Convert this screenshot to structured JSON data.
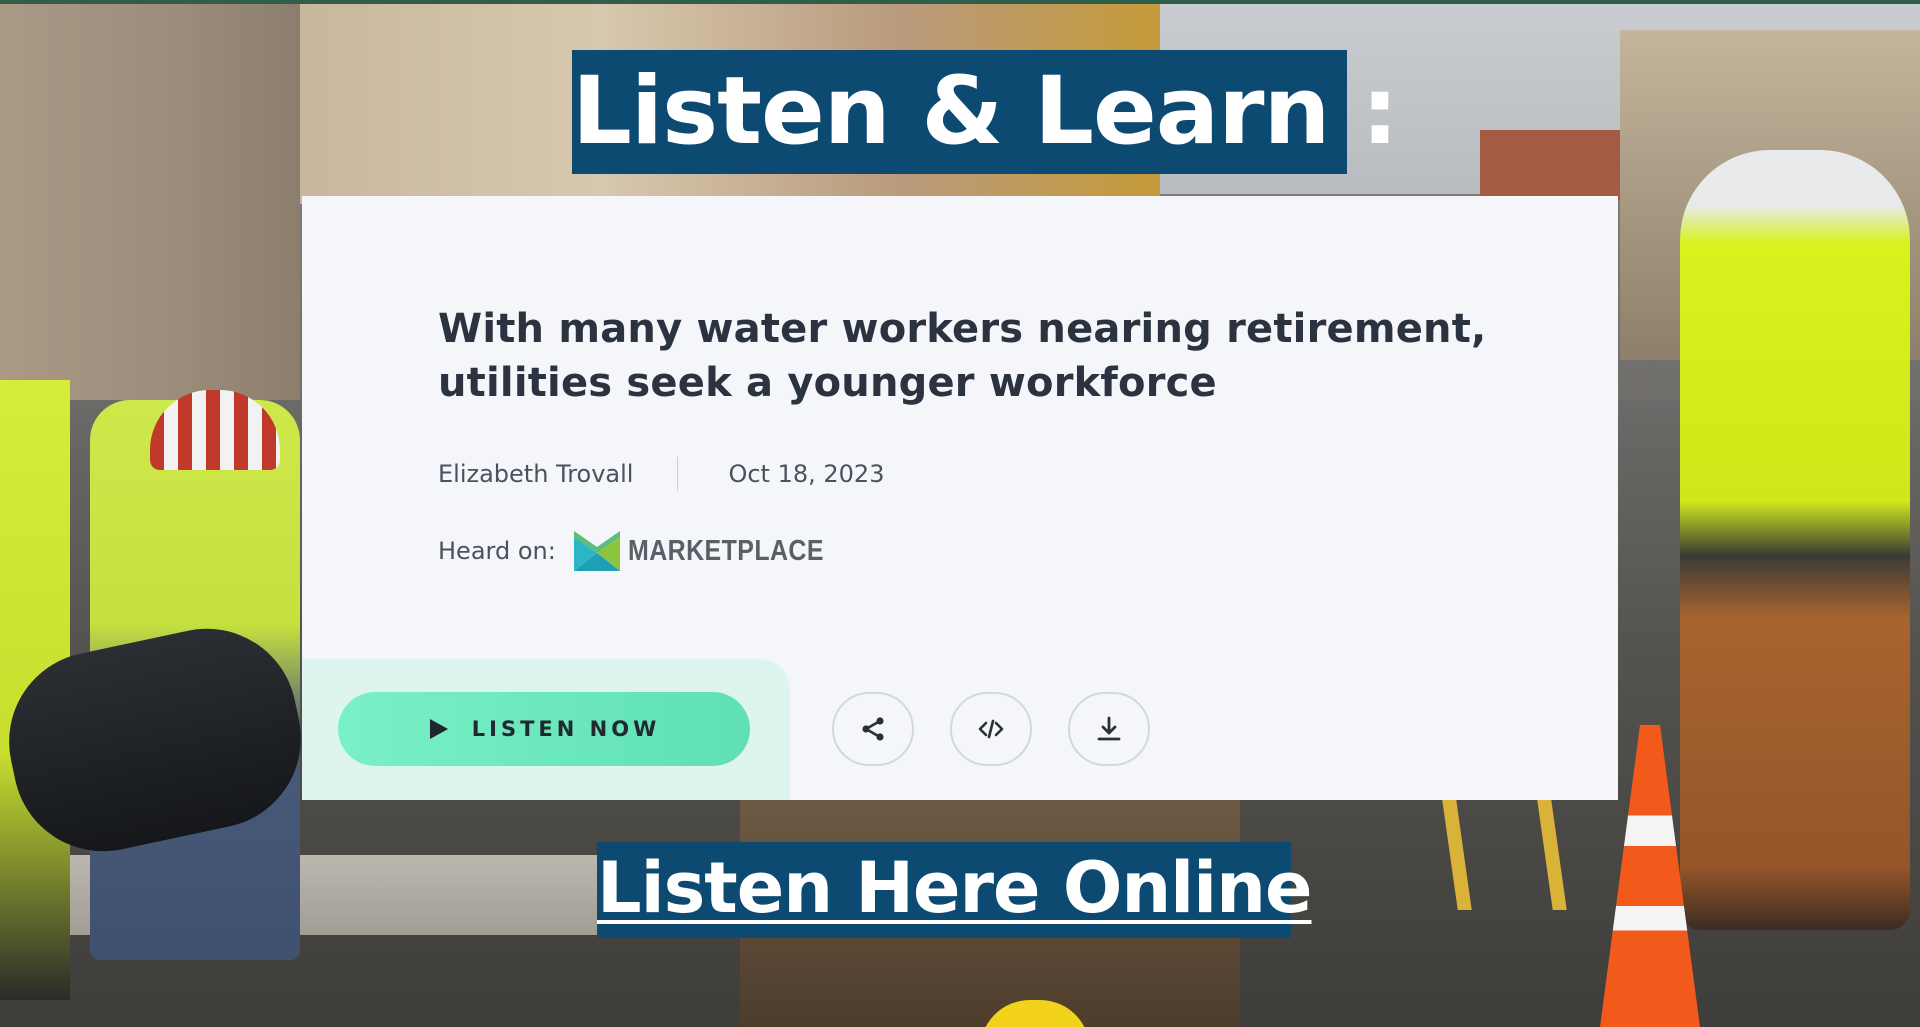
{
  "banner": {
    "headline": "Listen & Learn :",
    "link_text": "Listen Here Online",
    "color": "#0d4a72"
  },
  "article": {
    "title": "With many water workers nearing retirement, utilities seek a younger workforce",
    "author": "Elizabeth Trovall",
    "date": "Oct 18, 2023",
    "heard_on_label": "Heard on:",
    "program_logo_text": "MARKETPLACE",
    "program_logo_icon": "marketplace-logo-icon"
  },
  "actions": {
    "listen_label": "LISTEN NOW",
    "listen_icon": "play-icon",
    "share_icon": "share-icon",
    "embed_icon": "embed-code-icon",
    "download_icon": "download-icon",
    "accent_color": "#6fe9be"
  },
  "background": {
    "description_icon": "street-water-workers-photo"
  }
}
